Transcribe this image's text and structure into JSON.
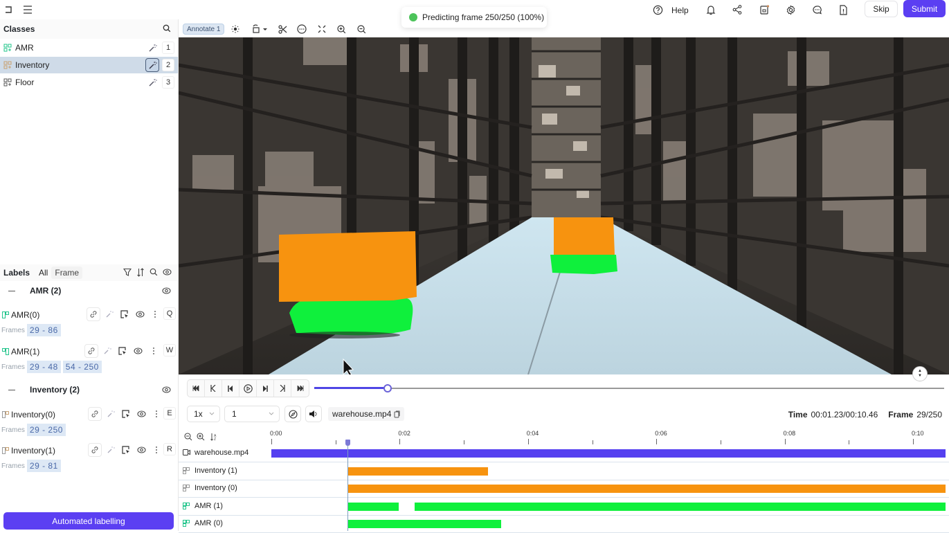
{
  "topbar": {
    "help_label": "Help",
    "skip_label": "Skip",
    "submit_label": "Submit",
    "icons": [
      "sidebar-toggle-icon",
      "menu-icon",
      "help-icon",
      "bell-icon",
      "share-icon",
      "save-draft-icon",
      "settings-icon",
      "comments-icon",
      "document-info-icon"
    ]
  },
  "toast": {
    "text": "Predicting frame 250/250 (100%)",
    "status_color": "#4cc35a"
  },
  "classes": {
    "title": "Classes",
    "items": [
      {
        "name": "AMR",
        "key": "1",
        "color": "#1fc48a",
        "selected": false
      },
      {
        "name": "Inventory",
        "key": "2",
        "color": "#c8a070",
        "selected": true
      },
      {
        "name": "Floor",
        "key": "3",
        "color": "#555555",
        "selected": false
      }
    ]
  },
  "labels": {
    "title": "Labels",
    "filter_all": "All",
    "filter_frame": "Frame",
    "frames_label": "Frames",
    "groups": [
      {
        "name": "AMR (2)",
        "items": [
          {
            "name": "AMR(0)",
            "key": "Q",
            "ranges": [
              "29 - 86"
            ]
          },
          {
            "name": "AMR(1)",
            "key": "W",
            "ranges": [
              "29 - 48",
              "54 - 250"
            ]
          }
        ]
      },
      {
        "name": "Inventory (2)",
        "items": [
          {
            "name": "Inventory(0)",
            "key": "E",
            "ranges": [
              "29 - 250"
            ]
          },
          {
            "name": "Inventory(1)",
            "key": "R",
            "ranges": [
              "29 - 81"
            ]
          }
        ]
      }
    ]
  },
  "automated_labelling_label": "Automated labelling",
  "canvas_toolbar": {
    "annotate_label": "Annotate 1"
  },
  "player": {
    "speed": "1x",
    "step": "1",
    "filename": "warehouse.mp4",
    "time_label": "Time",
    "time_value": "00:01.23/00:10.46",
    "frame_label": "Frame",
    "frame_value": "29/250",
    "current_frame": 29,
    "total_frames": 250,
    "progress_fraction": 0.116
  },
  "timeline": {
    "duration_seconds": 10.46,
    "tick_labels": [
      "0:00",
      "0:02",
      "0:04",
      "0:06",
      "0:08",
      "0:10"
    ],
    "rows": [
      {
        "name": "warehouse.mp4",
        "type": "video",
        "color": "#5540f0",
        "segments": [
          [
            1,
            250
          ]
        ]
      },
      {
        "name": "Inventory (1)",
        "type": "label",
        "color": "#f7930f",
        "segments": [
          [
            29,
            81
          ]
        ]
      },
      {
        "name": "Inventory (0)",
        "type": "label",
        "color": "#f7930f",
        "segments": [
          [
            29,
            250
          ]
        ]
      },
      {
        "name": "AMR (1)",
        "type": "label",
        "color": "#0ff03c",
        "segments": [
          [
            29,
            48
          ],
          [
            54,
            250
          ]
        ]
      },
      {
        "name": "AMR (0)",
        "type": "label",
        "color": "#0ff03c",
        "segments": [
          [
            29,
            86
          ]
        ]
      }
    ]
  },
  "colors": {
    "accent": "#5b3ff2",
    "inventory_mask": "#f7930f",
    "amr_mask": "#0ff03c"
  }
}
